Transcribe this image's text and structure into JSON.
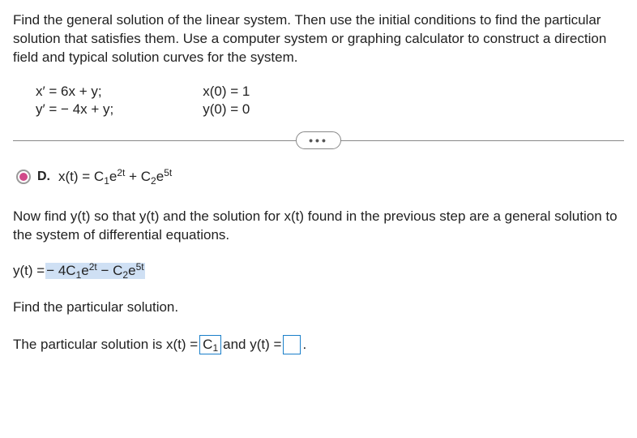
{
  "intro": "Find the general solution of the linear system. Then use the initial conditions to find the particular solution that satisfies them. Use a computer system or graphing calculator to construct a direction field and typical solution curves for the system.",
  "system": {
    "eq1": "x′ = 6x + y;",
    "eq2": "y′ = − 4x + y;",
    "ic1": "x(0) = 1",
    "ic2": "y(0) = 0"
  },
  "dots": "•••",
  "option": {
    "letter": "D.",
    "expr_prefix": "x(t) = C",
    "sub1": "1",
    "e1": "e",
    "exp1": "2t",
    "plus": " + C",
    "sub2": "2",
    "e2": "e",
    "exp2": "5t"
  },
  "prompt_yt": "Now find y(t) so that y(t) and the solution for x(t) found in the previous step are a general solution to the system of differential equations.",
  "yt_answer": {
    "prefix": "y(t) = ",
    "term1a": " − 4C",
    "sub1": "1",
    "e1": "e",
    "exp1": "2t",
    "minus": " − C",
    "sub2": "2",
    "e2": "e",
    "exp2": "5t"
  },
  "find_particular": "Find the particular solution.",
  "final": {
    "text1": "The particular solution is x(t) = ",
    "box1_content": "C",
    "box1_sub": "1",
    "text2": " and y(t) = ",
    "period": "."
  }
}
